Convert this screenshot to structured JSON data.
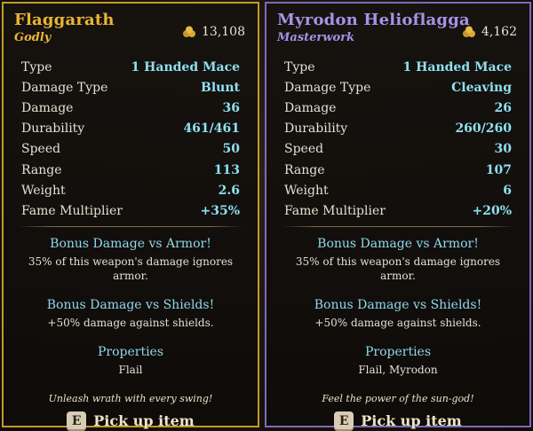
{
  "items": [
    {
      "name": "Flaggarath",
      "rarity": "Godly",
      "price": "13,108",
      "stats": [
        {
          "label": "Type",
          "value": "1 Handed Mace"
        },
        {
          "label": "Damage Type",
          "value": "Blunt"
        },
        {
          "label": "Damage",
          "value": "36"
        },
        {
          "label": "Durability",
          "value": "461/461"
        },
        {
          "label": "Speed",
          "value": "50"
        },
        {
          "label": "Range",
          "value": "113"
        },
        {
          "label": "Weight",
          "value": "2.6"
        },
        {
          "label": "Fame Multiplier",
          "value": "+35%"
        }
      ],
      "bonus_armor_title": "Bonus Damage vs Armor!",
      "bonus_armor_desc": "35% of this weapon's damage ignores armor.",
      "bonus_shields_title": "Bonus Damage vs Shields!",
      "bonus_shields_desc": "+50% damage against shields.",
      "properties_title": "Properties",
      "properties_value": "Flail",
      "flavor": "Unleash wrath with every swing!",
      "pickup_key": "E",
      "pickup_label": "Pick up item"
    },
    {
      "name": "Myrodon Helioflagga",
      "rarity": "Masterwork",
      "price": "4,162",
      "stats": [
        {
          "label": "Type",
          "value": "1 Handed Mace"
        },
        {
          "label": "Damage Type",
          "value": "Cleaving"
        },
        {
          "label": "Damage",
          "value": "26"
        },
        {
          "label": "Durability",
          "value": "260/260"
        },
        {
          "label": "Speed",
          "value": "30"
        },
        {
          "label": "Range",
          "value": "107"
        },
        {
          "label": "Weight",
          "value": "6"
        },
        {
          "label": "Fame Multiplier",
          "value": "+20%"
        }
      ],
      "bonus_armor_title": "Bonus Damage vs Armor!",
      "bonus_armor_desc": "35% of this weapon's damage ignores armor.",
      "bonus_shields_title": "Bonus Damage vs Shields!",
      "bonus_shields_desc": "+50% damage against shields.",
      "properties_title": "Properties",
      "properties_value": "Flail, Myrodon",
      "flavor": "Feel the power of the sun-god!",
      "pickup_key": "E",
      "pickup_label": "Pick up item"
    }
  ],
  "colors": {
    "godly": "#e9b533",
    "masterwork": "#a692e6",
    "stat_value": "#8fe0f0"
  }
}
